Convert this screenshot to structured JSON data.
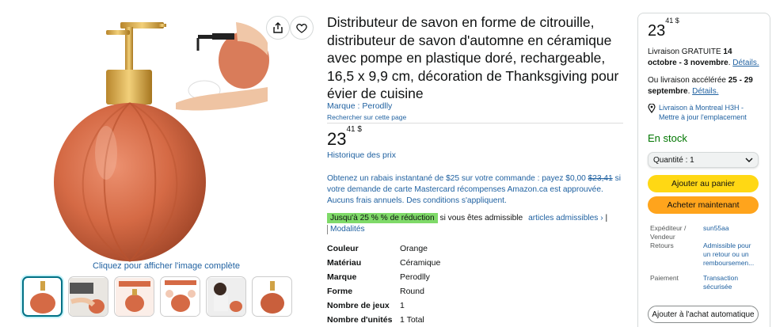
{
  "gallery": {
    "see_full_image": "Cliquez pour afficher l'image complète",
    "share_icon": "share-icon",
    "wishlist_icon": "heart-icon"
  },
  "product": {
    "title": "Distributeur de savon en forme de citrouille, distributeur de savon d'automne en céramique avec pompe en plastique doré, rechargeable, 16,5 x 9,9 cm, décoration de Thanksgiving pour évier de cuisine",
    "brand_label": "Marque : Perodlly",
    "search_page": "Rechercher sur cette page",
    "price_whole": "23",
    "price_fraction": "41",
    "price_currency": "$",
    "price_history": "Historique des prix",
    "promo_before": "Obtenez un rabais instantané de $25 sur votre commande : payez $0,00 ",
    "promo_strike": "$23,41",
    "promo_after": " si votre demande de carte Mastercard récompenses Amazon.ca est approuvée. Aucuns frais annuels. Des conditions s'appliquent.",
    "deal_badge": "Jusqu'à 25 % % de réduction",
    "deal_text": " si vous êtes admissible",
    "deal_link": "articles admissibles ›",
    "deal_sep": "|",
    "modalites": "Modalités",
    "specs": [
      {
        "key": "Couleur",
        "value": "Orange"
      },
      {
        "key": "Matériau",
        "value": "Céramique"
      },
      {
        "key": "Marque",
        "value": "Perodlly"
      },
      {
        "key": "Forme",
        "value": "Round"
      },
      {
        "key": "Nombre de jeux",
        "value": "1"
      },
      {
        "key": "Nombre d'unités",
        "value": "1 Total"
      }
    ]
  },
  "buybox": {
    "price_whole": "23",
    "price_fraction": "41",
    "price_currency": "$",
    "delivery_prefix": "Livraison GRATUITE ",
    "delivery_dates": "14 octobre - 3 novembre",
    "delivery_suffix": ". ",
    "details_link": "Détails.",
    "express_prefix": "Ou livraison accélérée ",
    "express_dates": "25 - 29 septembre",
    "express_suffix": ". ",
    "details_link2": "Détails.",
    "location": "Livraison à Montreal H3H - Mettre à jour l'emplacement",
    "stock": "En stock",
    "quantity": "Quantité : 1",
    "add_to_cart": "Ajouter au panier",
    "buy_now": "Acheter maintenant",
    "shipper_label": "Expéditeur / Vendeur",
    "shipper_value": "sun55aa",
    "returns_label": "Retours",
    "returns_value": "Admissible pour un retour ou un remboursemen...",
    "payment_label": "Paiement",
    "payment_value": "Transaction sécurisée",
    "auto_buy": "Ajouter à l'achat automatique"
  },
  "colors": {
    "link": "#2162a1",
    "cart": "#ffd814",
    "buy": "#ffa41c",
    "in_stock": "#007600",
    "deal": "#7fda69",
    "pumpkin": "#d86a44"
  }
}
